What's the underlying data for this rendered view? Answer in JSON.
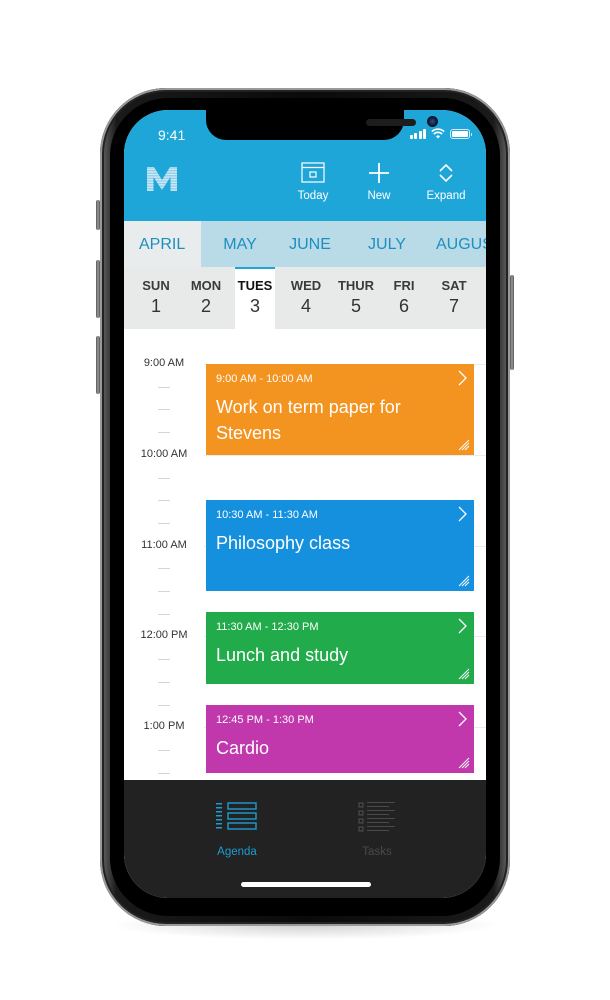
{
  "status_bar": {
    "time": "9:41"
  },
  "header": {
    "logo": "M",
    "actions": [
      {
        "id": "today",
        "label": "Today",
        "icon": "calendar-today-icon"
      },
      {
        "id": "new",
        "label": "New",
        "icon": "plus-icon"
      },
      {
        "id": "expand",
        "label": "Expand",
        "icon": "expand-chevrons-icon"
      }
    ]
  },
  "colors": {
    "header": "#1fa6d9",
    "months_bg": "#b9dbe8",
    "accent": "#1e9bd3",
    "event_orange": "#f39320",
    "event_blue": "#1590de",
    "event_green": "#22ab4b",
    "event_purple": "#c138ad"
  },
  "months": [
    "APRIL",
    "MAY",
    "JUNE",
    "JULY",
    "AUGUST"
  ],
  "current_month": "APRIL",
  "week": {
    "days": [
      {
        "name": "SUN",
        "date": "1"
      },
      {
        "name": "MON",
        "date": "2"
      },
      {
        "name": "TUES",
        "date": "3"
      },
      {
        "name": "WED",
        "date": "4"
      },
      {
        "name": "THUR",
        "date": "5"
      },
      {
        "name": "FRI",
        "date": "6"
      },
      {
        "name": "SAT",
        "date": "7"
      }
    ],
    "selected": "TUES"
  },
  "agenda": {
    "hours": [
      "9:00 AM",
      "10:00 AM",
      "11:00 AM",
      "12:00 PM",
      "1:00 PM"
    ],
    "events": [
      {
        "time": "9:00 AM - 10:00 AM",
        "title": "Work on term paper for Stevens",
        "color": "#f39320"
      },
      {
        "time": "10:30 AM - 11:30 AM",
        "title": "Philosophy class",
        "color": "#1590de"
      },
      {
        "time": "11:30 AM - 12:30 PM",
        "title": "Lunch and study",
        "color": "#22ab4b"
      },
      {
        "time": "12:45 PM - 1:30 PM",
        "title": "Cardio",
        "color": "#c138ad"
      }
    ]
  },
  "tabbar": {
    "tabs": [
      {
        "label": "Agenda",
        "icon": "agenda-list-icon",
        "active": true
      },
      {
        "label": "Tasks",
        "icon": "tasks-checklist-icon",
        "active": false
      }
    ]
  }
}
